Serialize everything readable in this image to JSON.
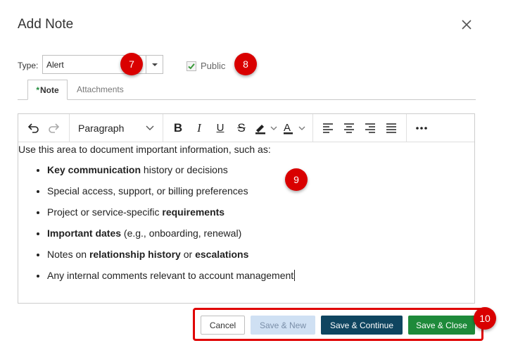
{
  "dialog": {
    "title": "Add Note"
  },
  "type_field": {
    "label": "Type:",
    "value": "Alert"
  },
  "public_checkbox": {
    "label": "Public",
    "checked": true
  },
  "tabs": [
    {
      "label": "Note",
      "required_marker": "*",
      "active": true
    },
    {
      "label": "Attachments",
      "active": false
    }
  ],
  "toolbar": {
    "block_format": "Paragraph"
  },
  "editor": {
    "intro": "Use this area to document important information, such as:",
    "items": [
      {
        "a": "Key communication",
        "b": " history or decisions"
      },
      {
        "a": "",
        "b": "Special access, support, or billing preferences"
      },
      {
        "a": "",
        "b": "Project or service-specific ",
        "c": "requirements"
      },
      {
        "a": "Important dates",
        "b": " (e.g., onboarding, renewal)"
      },
      {
        "a": "",
        "b": "Notes on ",
        "c": "relationship history",
        "d": " or ",
        "e": "escalations"
      },
      {
        "a": "",
        "b": "Any internal comments relevant to account management"
      }
    ]
  },
  "buttons": {
    "cancel": "Cancel",
    "save_new": "Save & New",
    "save_continue": "Save & Continue",
    "save_close": "Save & Close"
  },
  "callouts": {
    "c7": "7",
    "c8": "8",
    "c9": "9",
    "c10": "10"
  },
  "colors": {
    "primary": "#0f4560",
    "success": "#1e8a3a",
    "callout": "#d90000"
  }
}
